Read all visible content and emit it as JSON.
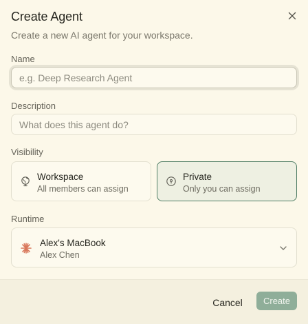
{
  "dialog": {
    "title": "Create Agent",
    "subtitle": "Create a new AI agent for your workspace."
  },
  "fields": {
    "name": {
      "label": "Name",
      "value": "",
      "placeholder": "e.g. Deep Research Agent"
    },
    "description": {
      "label": "Description",
      "value": "",
      "placeholder": "What does this agent do?"
    }
  },
  "visibility": {
    "label": "Visibility",
    "selected": "private",
    "options": [
      {
        "id": "workspace",
        "title": "Workspace",
        "subtitle": "All members can assign",
        "icon": "globe-icon"
      },
      {
        "id": "private",
        "title": "Private",
        "subtitle": "Only you can assign",
        "icon": "lock-icon"
      }
    ]
  },
  "runtime": {
    "label": "Runtime",
    "selected_name": "Alex's MacBook",
    "selected_owner": "Alex Chen",
    "icon": "burst-icon"
  },
  "footer": {
    "cancel_label": "Cancel",
    "create_label": "Create"
  },
  "colors": {
    "accent": "#4f7d64",
    "create_button": "#8fae99",
    "runtime_icon": "#d9775a",
    "background": "#fcf8e9"
  }
}
